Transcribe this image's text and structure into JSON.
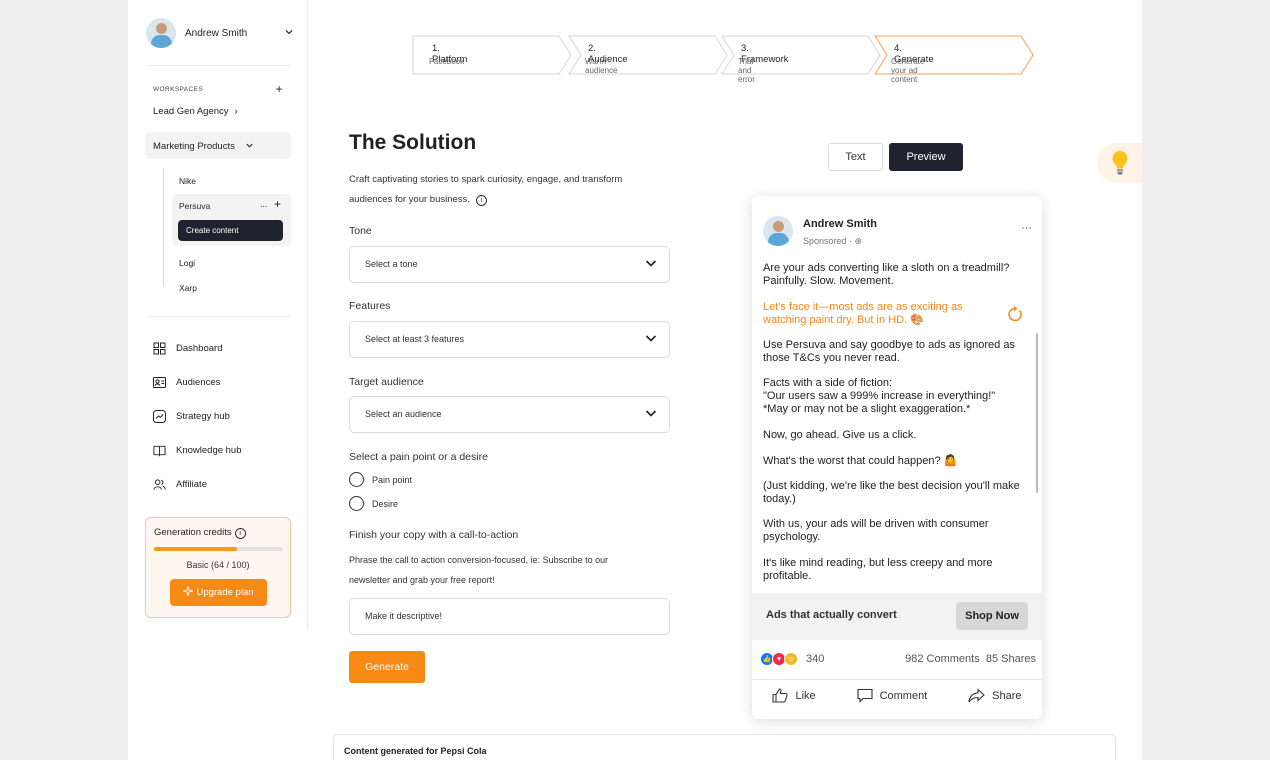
{
  "sidebar": {
    "user_name": "Andrew Smith",
    "workspaces_label": "WORKSPACES",
    "workspace": "Lead Gen Agency",
    "project": "Marketing Products",
    "sub_items": [
      "Nike",
      "Persuva",
      "Logi",
      "Xarp"
    ],
    "create_content": "Create content",
    "nav": [
      "Dashboard",
      "Audiences",
      "Strategy hub",
      "Knowledge hub",
      "Affiliate"
    ],
    "credits_title": "Generation credits",
    "credits_used": 64,
    "credits_total": 100,
    "plan_label": "Basic (64 / 100)",
    "upgrade_label": "Upgrade plan"
  },
  "steps": [
    {
      "title": "1. Platform",
      "subtitle": "Facebook"
    },
    {
      "title": "2. Audience",
      "subtitle": "Warm audience"
    },
    {
      "title": "3. Framework",
      "subtitle": "Trial and error"
    },
    {
      "title": "4. Generate",
      "subtitle": "Generate your ad content"
    }
  ],
  "form": {
    "title": "The Solution",
    "description": "Craft captivating stories to spark curiosity, engage, and transform audiences for your business.",
    "tone_label": "Tone",
    "tone_placeholder": "Select a tone",
    "features_label": "Features",
    "features_placeholder": "Select at least 3 features",
    "audience_label": "Target audience",
    "audience_placeholder": "Select an audience",
    "pain_label": "Select a pain point or a desire",
    "pain_options": [
      "Pain point",
      "Desire"
    ],
    "cta_label": "Finish your copy with a call-to-action",
    "cta_hint": "Phrase the call to action conversion-focused, ie: Subscribe to our newsletter and grab your free report!",
    "cta_placeholder": "Make it descriptive!",
    "generate_label": "Generate"
  },
  "view_tabs": {
    "text": "Text",
    "preview": "Preview"
  },
  "ad": {
    "name": "Andrew Smith",
    "sponsored": "Sponsored",
    "more": "···",
    "paragraphs": [
      "Are your ads converting like a sloth on a treadmill? Painfully. Slow. Movement.",
      "Let's face it—most ads are as exciting as watching paint dry. But in HD. 🎨",
      "Use Persuva and say goodbye to ads as ignored as those T&Cs you never read.",
      "Facts with a side of fiction:\n\"Our users saw a 999% increase in everything!\"\n*May or may not be a slight exaggeration.*",
      "Now, go ahead. Give us a click.",
      "What's the worst that could happen? 🤷",
      "(Just kidding, we're like the best decision you'll make today.)",
      "With us, your ads will be driven with consumer psychology.",
      "It's like mind reading, but less creepy and more profitable."
    ],
    "cta_text": "Ads that actually convert",
    "shop_now": "Shop Now",
    "reactions": "340",
    "comments": "982 Comments",
    "shares": "85 Shares",
    "like": "Like",
    "comment": "Comment",
    "share": "Share"
  },
  "bottom": {
    "title": "Content generated for Pepsi Cola"
  },
  "colors": {
    "accent": "#f78a14",
    "dark": "#21222f",
    "orange_text": "#f5871b"
  }
}
